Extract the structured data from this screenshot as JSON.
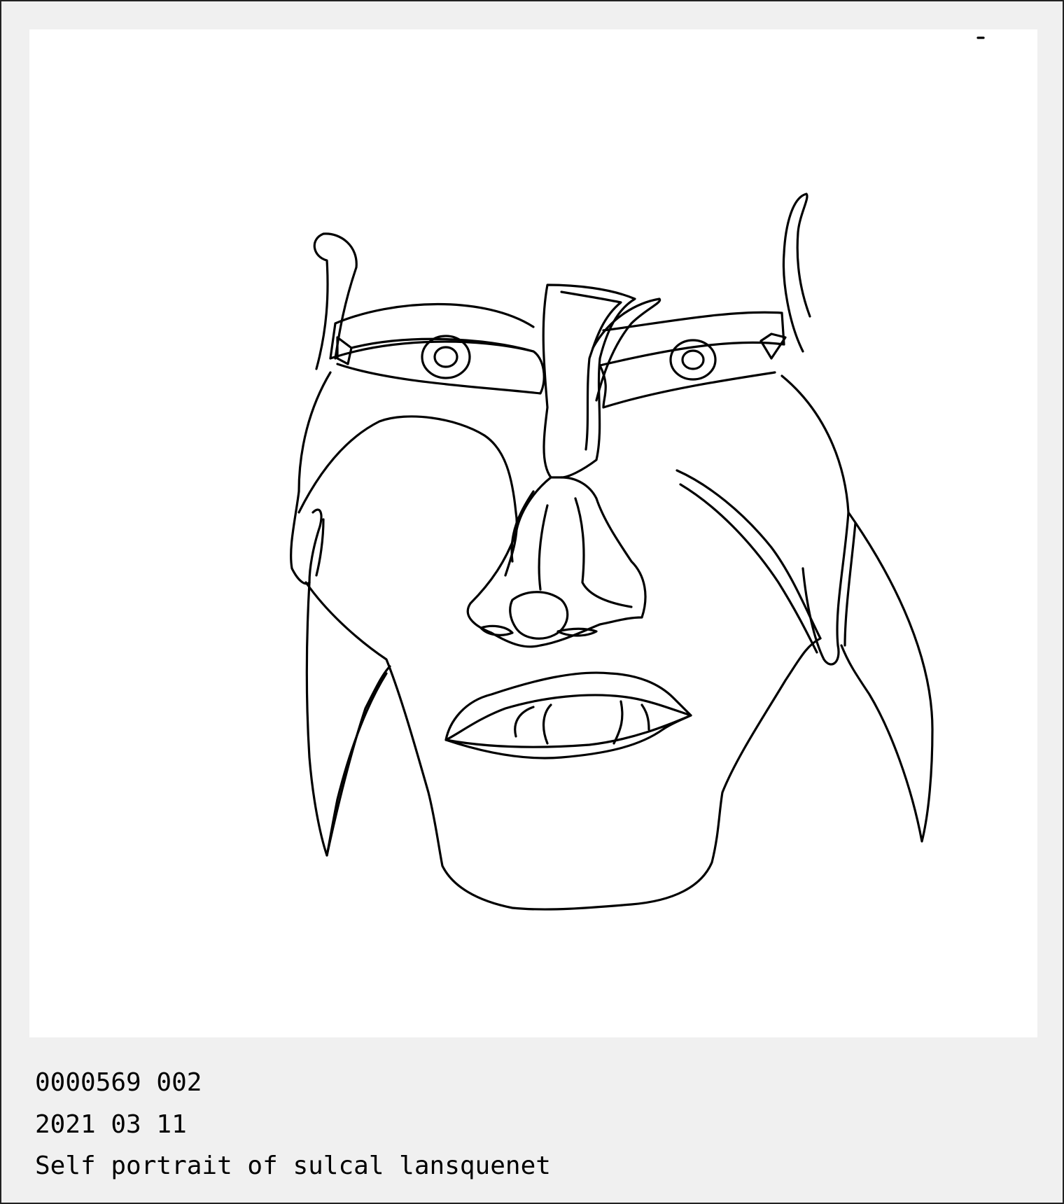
{
  "caption": {
    "id_line": "0000569 002",
    "date_line": "2021 03 11",
    "title_line": "Self portrait of sulcal lansquenet"
  },
  "colors": {
    "background": "#f0f0f0",
    "canvas": "#ffffff",
    "ink": "#000000"
  },
  "artwork": {
    "description_icon": "line-drawing-portrait"
  }
}
